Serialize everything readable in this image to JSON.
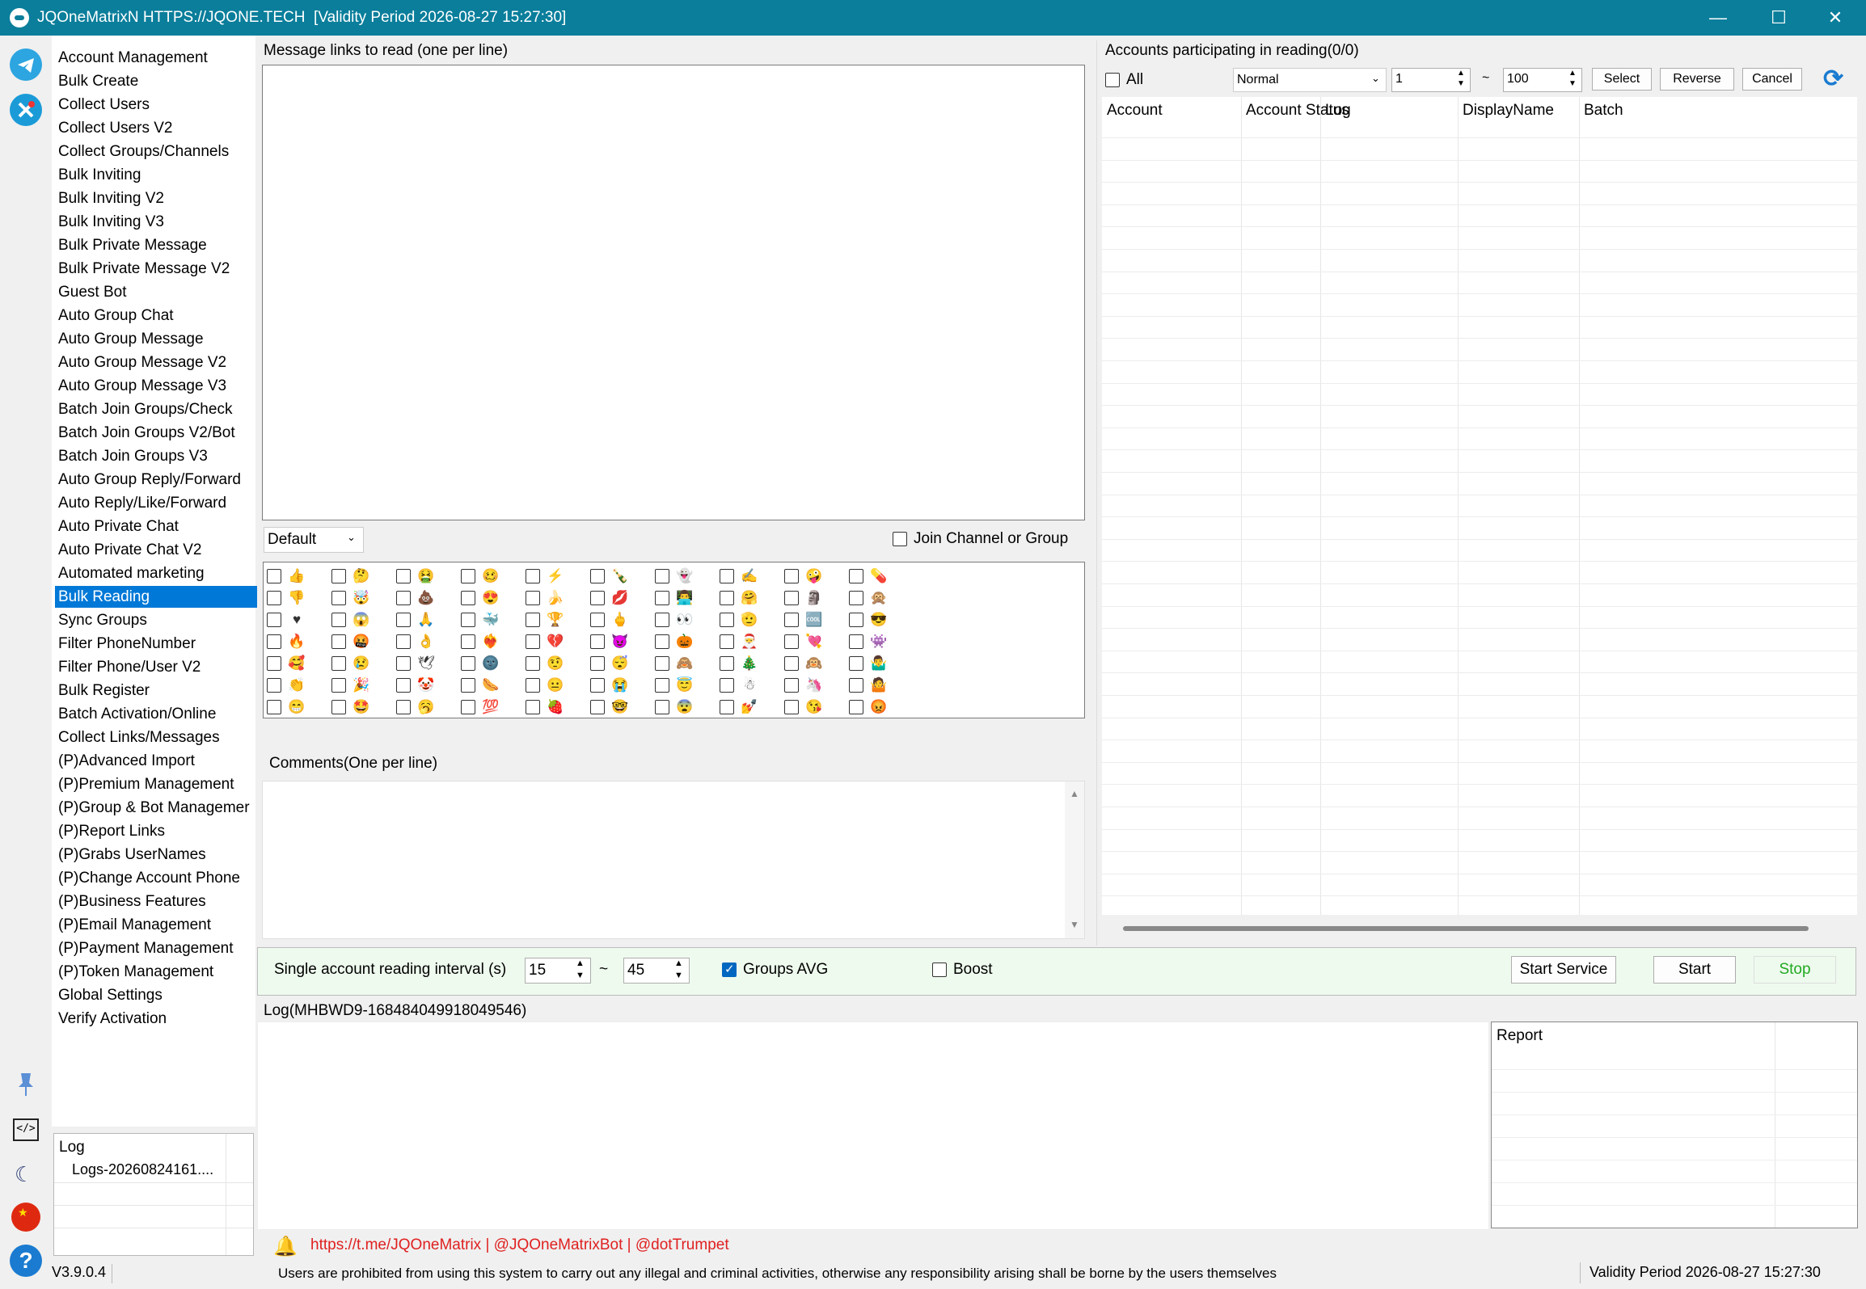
{
  "window": {
    "title": "JQOneMatrixN HTTPS://JQONE.TECH  [Validity Period 2026-08-27 15:27:30]",
    "minimize": "—",
    "maximize": "☐",
    "close": "✕"
  },
  "nav": {
    "items": [
      "Account Management",
      "Bulk Create",
      "Collect Users",
      "Collect Users V2",
      "Collect Groups/Channels",
      "Bulk Inviting",
      "Bulk Inviting V2",
      "Bulk Inviting V3",
      "Bulk Private Message",
      "Bulk Private Message V2",
      "Guest Bot",
      "Auto Group Chat",
      "Auto Group Message",
      "Auto Group Message V2",
      "Auto Group Message V3",
      "Batch Join Groups/Check",
      "Batch Join Groups V2/Bot",
      "Batch Join Groups V3",
      "Auto Group Reply/Forward",
      "Auto Reply/Like/Forward",
      "Auto Private Chat",
      "Auto Private Chat V2",
      "Automated marketing",
      "Bulk Reading",
      "Sync Groups",
      "Filter PhoneNumber",
      "Filter Phone/User V2",
      "Bulk Register",
      "Batch Activation/Online",
      "Collect Links/Messages",
      "(P)Advanced Import",
      "(P)Premium Management",
      "(P)Group & Bot Managemer",
      "(P)Report Links",
      "(P)Grabs UserNames",
      "(P)Change Account Phone",
      "(P)Business Features",
      "(P)Email Management",
      "(P)Payment Management",
      "(P)Token Management",
      "Global Settings",
      "Verify Activation"
    ],
    "active_index": 23
  },
  "logs_panel": {
    "header": "Log",
    "item": "Logs-20260824161...."
  },
  "version": "V3.9.0.4",
  "links": {
    "label": "Message links to read (one per line)",
    "mode": "Default",
    "join_label": "Join Channel or Group",
    "join_checked": false
  },
  "reactions": {
    "icons": [
      [
        "👍",
        "👎",
        "♥",
        "🔥",
        "🥰",
        "👏",
        "😁"
      ],
      [
        "🤔",
        "🤯",
        "😱",
        "🤬",
        "😢",
        "🎉",
        "🤩"
      ],
      [
        "🤮",
        "💩",
        "🙏",
        "👌",
        "🕊",
        "🤡",
        "🥱"
      ],
      [
        "🥴",
        "😍",
        "🐳",
        "❤‍🔥",
        "🌚",
        "🌭",
        "💯"
      ],
      [
        "⚡",
        "🍌",
        "🏆",
        "💔",
        "🤨",
        "😐",
        "🍓"
      ],
      [
        "🍾",
        "💋",
        "🖕",
        "😈",
        "😴",
        "😭",
        "🤓"
      ],
      [
        "👻",
        "👨‍💻",
        "👀",
        "🎃",
        "🙈",
        "😇",
        "😨"
      ],
      [
        "✍",
        "🤗",
        "🫡",
        "🎅",
        "🎄",
        "☃",
        "💅"
      ],
      [
        "🤪",
        "🗿",
        "🆒",
        "💘",
        "🙉",
        "🦄",
        "😘"
      ],
      [
        "💊",
        "🙊",
        "😎",
        "👾",
        "🤷‍♂",
        "🤷",
        "😡"
      ]
    ]
  },
  "comments": {
    "label": "Comments(One per line)"
  },
  "accounts": {
    "title": "Accounts participating in reading(0/0)",
    "all_label": "All",
    "filter": "Normal",
    "from": "1",
    "tilde": "~",
    "to": "100",
    "select_btn": "Select",
    "reverse_btn": "Reverse",
    "cancel_btn": "Cancel",
    "columns": [
      "Account",
      "Account Status",
      "Log",
      "DisplayName",
      "Batch"
    ]
  },
  "settings": {
    "interval_label": "Single account reading interval (s)",
    "min": "15",
    "tilde": "~",
    "max": "45",
    "groups_avg_label": "Groups AVG",
    "groups_avg_checked": true,
    "boost_label": "Boost",
    "boost_checked": false,
    "start_service_btn": "Start Service",
    "start_btn": "Start",
    "stop_btn": "Stop"
  },
  "log": {
    "label": "Log(MHBWD9-168484049918049546)",
    "report_header": "Report"
  },
  "footer": {
    "links": "https://t.me/JQOneMatrix | @JQOneMatrixBot | @dotTrumpet",
    "disclaimer": "Users are prohibited from using this system to carry out any illegal and criminal activities, otherwise any responsibility arising shall be borne by the users themselves",
    "validity": "Validity Period 2026-08-27 15:27:30"
  },
  "colors": {
    "accent": "#0a7e9b",
    "selection": "#0078d7",
    "link_red": "#e02020",
    "stop_green": "#22aa22",
    "settings_bg": "#eefaee"
  }
}
